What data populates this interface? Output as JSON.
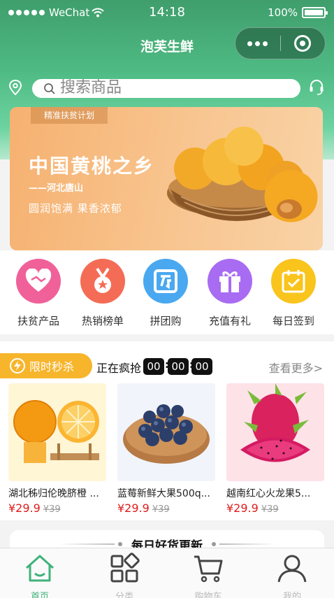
{
  "status_bar": {
    "carrier": "WeChat",
    "time": "14:18",
    "battery": "100%",
    "battery_level": 1.0
  },
  "nav": {
    "title": "泡芙生鲜",
    "more_icon": "more-dots-icon",
    "close_icon": "target-icon"
  },
  "search": {
    "placeholder": "搜索商品",
    "location_icon": "location-pin-icon",
    "service_icon": "headset-icon"
  },
  "banner": {
    "tag": "精准扶贫计划",
    "headline": "中国黄桃之乡",
    "subline": "——河北唐山",
    "slogan": "圆润饱满 果香浓郁"
  },
  "shortcuts": [
    {
      "label": "扶贫产品",
      "icon": "heart-handshake-icon",
      "color": "#f0619a"
    },
    {
      "label": "热销榜单",
      "icon": "medal-icon",
      "color": "#f46c55"
    },
    {
      "label": "拼团购",
      "icon": "group-buy-icon",
      "color": "#4aa8f0"
    },
    {
      "label": "充值有礼",
      "icon": "gift-icon",
      "color": "#a86cf2"
    },
    {
      "label": "每日签到",
      "icon": "calendar-check-icon",
      "color": "#f9c41c"
    }
  ],
  "flash_sale": {
    "badge": "限时秒杀",
    "status": "正在疯抢",
    "countdown": {
      "hours": "00",
      "minutes": "00",
      "seconds": "00"
    },
    "more": "查看更多>",
    "products": [
      {
        "name": "湖北秭归伦晚脐橙 ...",
        "price": "¥29.9",
        "old_price": "¥39"
      },
      {
        "name": "蓝莓新鲜大果500q...",
        "price": "¥29.9",
        "old_price": "¥39"
      },
      {
        "name": "越南红心火龙果5...",
        "price": "¥29.9",
        "old_price": "¥39"
      }
    ]
  },
  "daily": {
    "title": "每日好货更新"
  },
  "tabs": [
    {
      "label": "首页",
      "icon": "home-icon",
      "active": true
    },
    {
      "label": "分类",
      "icon": "category-icon",
      "active": false
    },
    {
      "label": "购物车",
      "icon": "cart-icon",
      "active": false
    },
    {
      "label": "我的",
      "icon": "user-icon",
      "active": false
    }
  ],
  "colors": {
    "primary": "#4fbb84",
    "accent": "#f7b52c",
    "price": "#e01b1b"
  }
}
